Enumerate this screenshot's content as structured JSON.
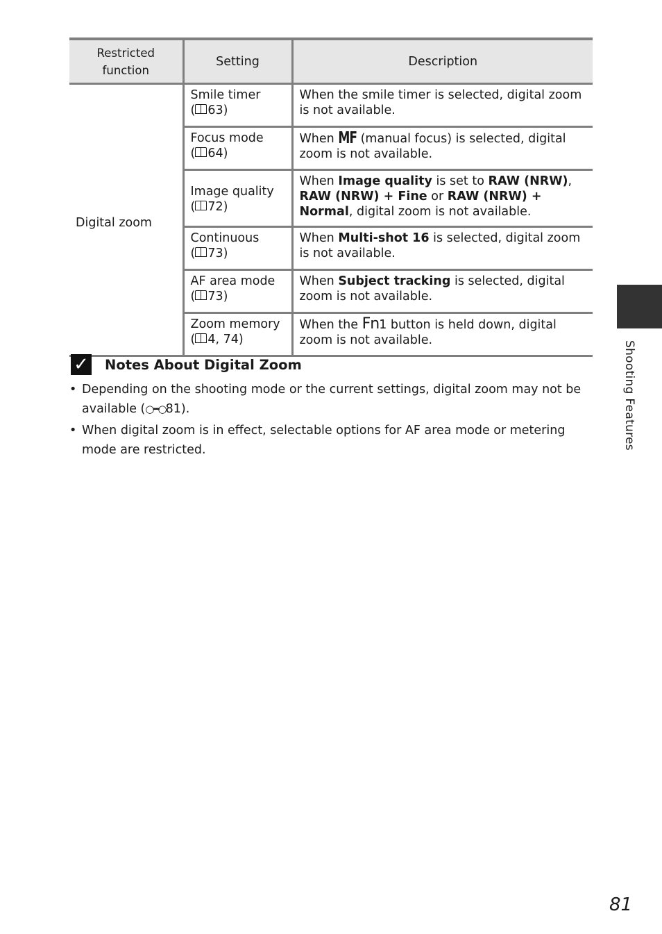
{
  "table": {
    "headers": {
      "restricted_function": "Restricted function",
      "setting": "Setting",
      "description": "Description"
    },
    "restricted_function": "Digital zoom",
    "rows": [
      {
        "setting": "Smile timer",
        "ref_open": "(",
        "ref_page": "63)",
        "description_parts": [
          "When the smile timer is selected, digital zoom is not available."
        ]
      },
      {
        "setting": "Focus mode",
        "ref_open": "(",
        "ref_page": "64)",
        "desc_pre": "When ",
        "desc_icon": "MF",
        "desc_post": " (manual focus) is selected, digital zoom is not available."
      },
      {
        "setting": "Image quality",
        "ref_open": "(",
        "ref_page": "72)",
        "d1": "When ",
        "d2": "Image quality",
        "d3": " is set to ",
        "d4": "RAW (NRW)",
        "d5": ", ",
        "d6": "RAW (NRW) + Fine",
        "d7": " or ",
        "d8": "RAW (NRW) + Normal",
        "d9": ", digital zoom is not available."
      },
      {
        "setting": "Continuous",
        "ref_open": "(",
        "ref_page": "73)",
        "d1": "When ",
        "d2": "Multi-shot 16",
        "d3": " is selected, digital zoom is not available."
      },
      {
        "setting": "AF area mode",
        "ref_open": "(",
        "ref_page": "73)",
        "d1": "When ",
        "d2": "Subject tracking",
        "d3": " is selected, digital zoom is not available."
      },
      {
        "setting": "Zoom memory",
        "ref_open": "(",
        "ref_page": "4, 74)",
        "d1": "When the ",
        "d_icon": "Fn",
        "d2": "1 button is held down, digital zoom is not available."
      }
    ]
  },
  "notes": {
    "icon": "check-icon",
    "title": "Notes About Digital Zoom",
    "items": [
      {
        "pre": "Depending on the shooting mode or the current settings, digital zoom may not be available (",
        "ref_icon": "○━○",
        "post": "81)."
      },
      {
        "text": "When digital zoom is in effect, selectable options for AF area mode or metering mode are restricted."
      }
    ]
  },
  "side_tab": {
    "label": "Shooting Features"
  },
  "page_number": "81"
}
